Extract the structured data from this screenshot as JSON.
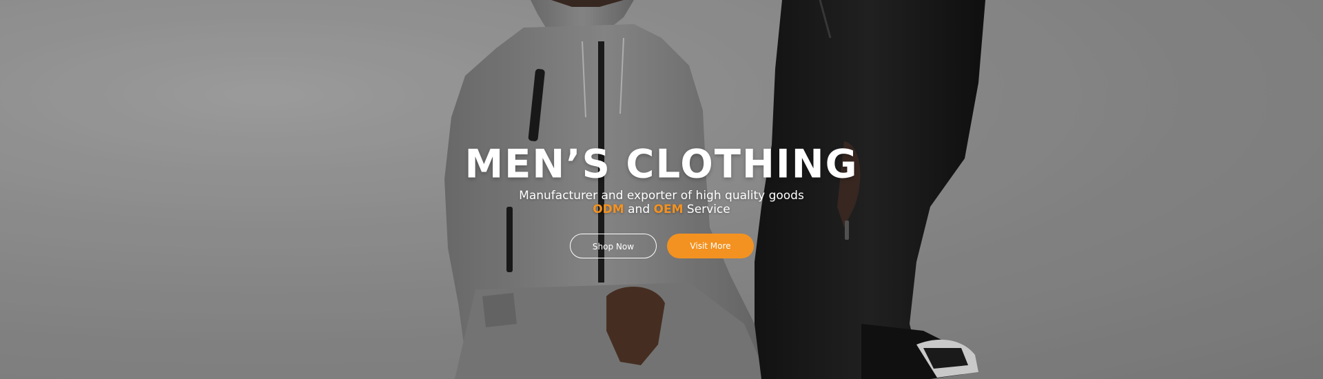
{
  "hero": {
    "title": "MEN’S CLOTHING",
    "subtitle": "Manufacturer and exporter of high quality goods",
    "service": {
      "odm": "ODM",
      "and": "and",
      "oem": "OEM",
      "suffix": "Service"
    },
    "buttons": {
      "shop_now": "Shop Now",
      "visit_more": "Visit More"
    }
  },
  "colors": {
    "accent": "#f39220",
    "text": "#ffffff",
    "background": "#8f8f8f"
  },
  "images": {
    "background": "studio-photo-two-men-wearing-grey-and-black-tracksuits"
  }
}
